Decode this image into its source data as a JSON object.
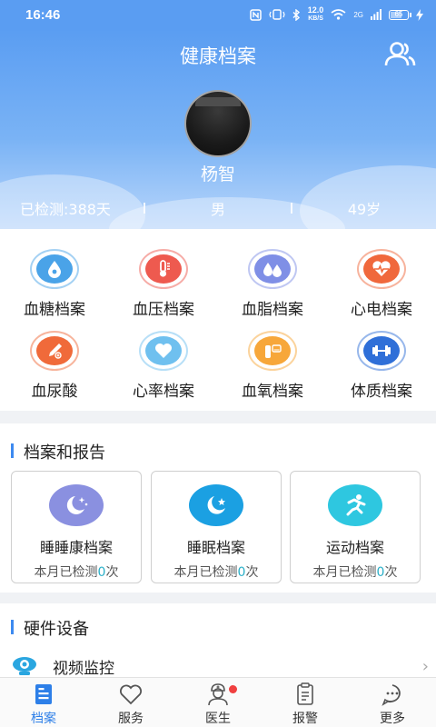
{
  "status_bar": {
    "time": "16:46",
    "net_speed_top": "12.0",
    "net_speed_bottom": "KB/S",
    "signal": "2G",
    "battery": "65"
  },
  "header": {
    "title": "健康档案",
    "user_name": "杨智",
    "detected_days": "已检测:388天",
    "gender": "男",
    "age": "49岁"
  },
  "archives": [
    {
      "label": "血糖档案",
      "color": "#4aa3e8",
      "icon": "blood-drop-icon"
    },
    {
      "label": "血压档案",
      "color": "#ee5a4f",
      "icon": "thermometer-icon"
    },
    {
      "label": "血脂档案",
      "color": "#7f8fe6",
      "icon": "drops-icon"
    },
    {
      "label": "心电档案",
      "color": "#f0683c",
      "icon": "ecg-heart-icon"
    },
    {
      "label": "血尿酸",
      "color": "#f06a3a",
      "icon": "dropper-icon"
    },
    {
      "label": "心率档案",
      "color": "#6fc0ef",
      "icon": "heart-icon"
    },
    {
      "label": "血氧档案",
      "color": "#f7a73a",
      "icon": "oximeter-icon"
    },
    {
      "label": "体质档案",
      "color": "#2f6fd8",
      "icon": "dumbbell-icon"
    }
  ],
  "reports": {
    "title": "档案和报告",
    "cards": [
      {
        "title": "睡睡康档案",
        "prefix": "本月已检测",
        "count": "0",
        "suffix": "次",
        "color": "#8a90e0",
        "icon": "moon-stars-icon"
      },
      {
        "title": "睡眠档案",
        "prefix": "本月已检测",
        "count": "0",
        "suffix": "次",
        "color": "#1ba0e2",
        "icon": "moon-star-icon"
      },
      {
        "title": "运动档案",
        "prefix": "本月已检测",
        "count": "0",
        "suffix": "次",
        "color": "#2ec7e0",
        "icon": "runner-icon"
      }
    ]
  },
  "hardware": {
    "title": "硬件设备",
    "items": [
      {
        "label": "视频监控",
        "icon": "camera-icon"
      }
    ]
  },
  "bottom_nav": [
    {
      "label": "档案",
      "active": true,
      "icon": "archive-icon"
    },
    {
      "label": "服务",
      "active": false,
      "icon": "heart-outline-icon"
    },
    {
      "label": "医生",
      "active": false,
      "icon": "doctor-icon"
    },
    {
      "label": "报警",
      "active": false,
      "icon": "report-icon"
    },
    {
      "label": "更多",
      "active": false,
      "icon": "more-icon"
    }
  ],
  "colors": {
    "accent": "#2d7fe8",
    "header_top": "#5a9df2",
    "count_highlight": "#2bb0c9"
  }
}
